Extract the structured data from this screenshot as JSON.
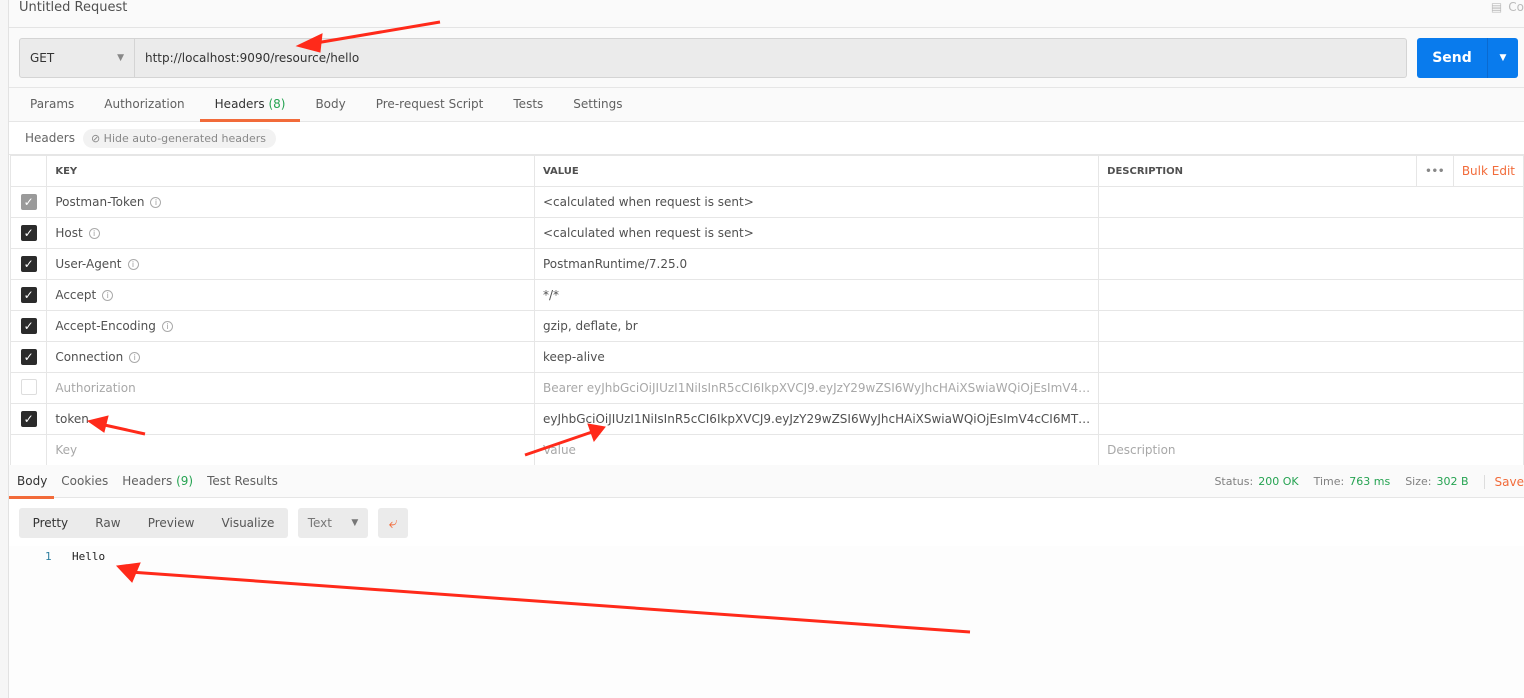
{
  "title": "Untitled Request",
  "comments_label": "Co",
  "request": {
    "method": "GET",
    "url": "http://localhost:9090/resource/hello",
    "send_label": "Send"
  },
  "request_tabs": [
    {
      "label": "Params"
    },
    {
      "label": "Authorization"
    },
    {
      "label": "Headers",
      "count": "(8)"
    },
    {
      "label": "Body"
    },
    {
      "label": "Pre-request Script"
    },
    {
      "label": "Tests"
    },
    {
      "label": "Settings"
    }
  ],
  "headers_bar": {
    "label": "Headers",
    "hide_auto": "Hide auto-generated headers"
  },
  "table": {
    "columns": {
      "key": "KEY",
      "value": "VALUE",
      "description": "DESCRIPTION",
      "more": "•••",
      "bulk_edit": "Bulk Edit"
    },
    "rows": [
      {
        "key": "Postman-Token",
        "value": "<calculated when request is sent>",
        "checked": "disabled"
      },
      {
        "key": "Host",
        "value": "<calculated when request is sent>",
        "checked": true
      },
      {
        "key": "User-Agent",
        "value": "PostmanRuntime/7.25.0",
        "checked": true
      },
      {
        "key": "Accept",
        "value": "*/*",
        "checked": true
      },
      {
        "key": "Accept-Encoding",
        "value": "gzip, deflate, br",
        "checked": true
      },
      {
        "key": "Connection",
        "value": "keep-alive",
        "checked": true
      },
      {
        "key": "Authorization",
        "value": "Bearer eyJhbGciOiJIUzI1NiIsInR5cCI6IkpXVCJ9.eyJzY29wZSI6WyJhcHAiXSwiaWQiOjEsImV4…",
        "checked": false
      },
      {
        "key": "token",
        "value": "eyJhbGciOiJIUzI1NiIsInR5cCI6IkpXVCJ9.eyJzY29wZSI6WyJhcHAiXSwiaWQiOjEsImV4cCI6MT…",
        "checked": true
      }
    ],
    "placeholder": {
      "key": "Key",
      "value": "Value",
      "description": "Description"
    }
  },
  "response_tabs": [
    {
      "label": "Body"
    },
    {
      "label": "Cookies"
    },
    {
      "label": "Headers",
      "count": "(9)"
    },
    {
      "label": "Test Results"
    }
  ],
  "status": {
    "status_label": "Status:",
    "status": "200 OK",
    "time_label": "Time:",
    "time": "763 ms",
    "size_label": "Size:",
    "size": "302 B",
    "save": "Save"
  },
  "view_modes": [
    "Pretty",
    "Raw",
    "Preview",
    "Visualize"
  ],
  "format": "Text",
  "code": {
    "line": "1",
    "text": "Hello"
  },
  "colors": {
    "accent": "#f26b3a",
    "send": "#097bed",
    "success": "#26a352",
    "annotation": "#ff2a1a"
  }
}
